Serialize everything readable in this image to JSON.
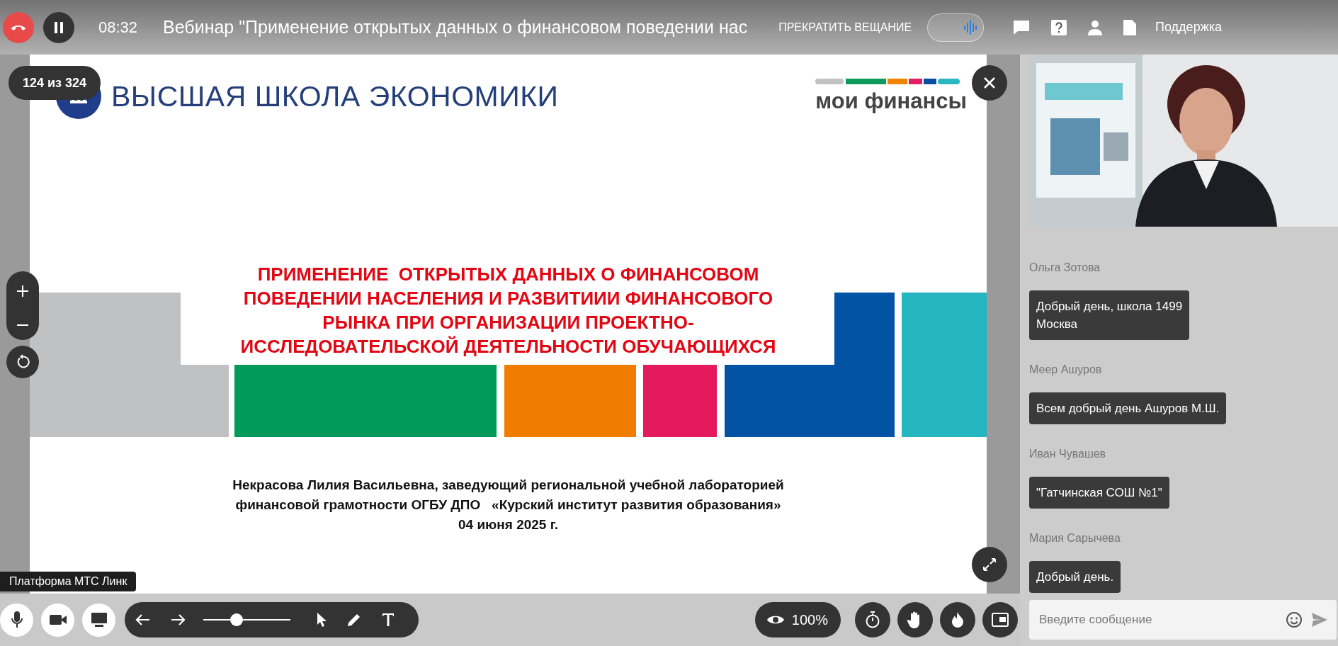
{
  "header": {
    "time": "08:32",
    "title": "Вебинар \"Применение открытых данных о финансовом поведении нас",
    "stop_button": "ПРЕКРАТИТЬ ВЕЩАНИЕ",
    "support": "Поддержка"
  },
  "slide": {
    "counter": "124 из 324",
    "org_name": "ВЫСШАЯ ШКОЛА ЭКОНОМИКИ",
    "brand": "мои финансы",
    "title_lines": [
      "ПРИМЕНЕНИЕ  ОТКРЫТЫХ ДАННЫХ О ФИНАНСОВОМ",
      "ПОВЕДЕНИИ НАСЕЛЕНИЯ И РАЗВИТИИИ ФИНАНСОВОГО",
      "РЫНКА ПРИ ОРГАНИЗАЦИИ ПРОЕКТНО-",
      "ИССЛЕДОВАТЕЛЬСКОЙ ДЕЯТЕЛЬНОСТИ ОБУЧАЮЩИХСЯ"
    ],
    "author_lines": [
      "Некрасова Лилия Васильевна, заведующий региональной учебной лабораторией",
      "финансовой грамотности ОГБУ ДПО   «Курский институт развития образования»",
      "04 июня 2025 г."
    ]
  },
  "tooltip": "Платформа МТС Линк",
  "toolbar": {
    "brush_size": {
      "level": 0.38
    },
    "zoom": "100%"
  },
  "chat": {
    "messages": [
      {
        "author": "Ольга Зотова",
        "text": "Добрый день, школа 1499\nМосква"
      },
      {
        "author": "Меер Ашуров",
        "text": "Всем добрый день Ашуров М.Ш."
      },
      {
        "author": "Иван Чувашев",
        "text": "\"Гатчинская СОШ №1\""
      },
      {
        "author": "Мария Сарычева",
        "text": "Добрый день."
      }
    ],
    "input": {
      "placeholder": "Введите сообщение"
    }
  }
}
